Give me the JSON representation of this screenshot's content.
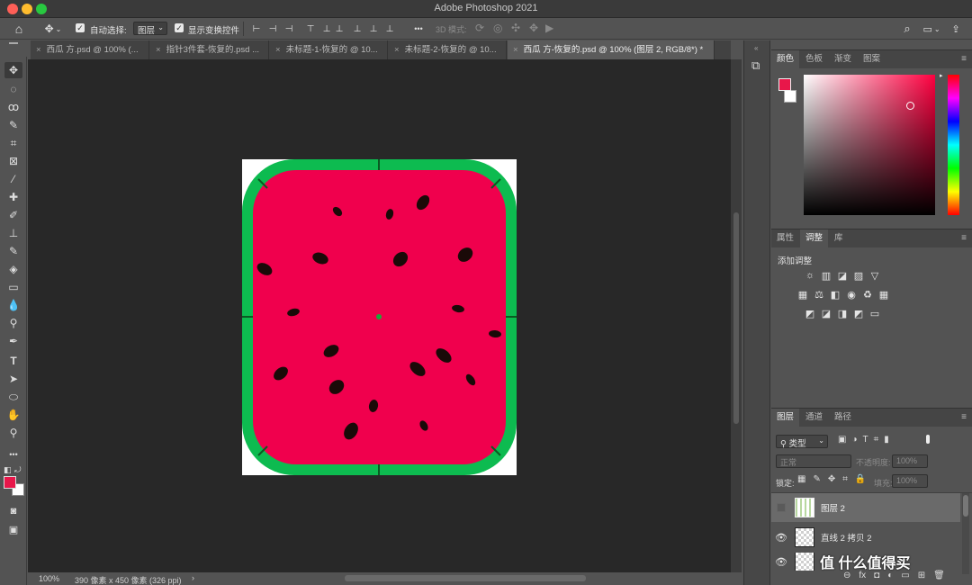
{
  "window": {
    "title": "Adobe Photoshop 2021",
    "traffic_colors": [
      "#fe5f57",
      "#febc2e",
      "#28c840"
    ]
  },
  "options": {
    "auto_select_label": "自动选择:",
    "auto_select_value": "图层",
    "show_transform_label": "显示变换控件",
    "mode_3d_label": "3D 模式:",
    "more_label": "•••"
  },
  "tabs": [
    {
      "label": "西瓜 方.psd @ 100% (..."
    },
    {
      "label": "指针3件套-恢复的.psd ..."
    },
    {
      "label": "未标题-1-恢复的 @ 10..."
    },
    {
      "label": "未标题-2-恢复的 @ 10..."
    },
    {
      "label": "西瓜 方-恢复的.psd @ 100% (图层 2, RGB/8*) *"
    }
  ],
  "tab_close": "×",
  "status": {
    "zoom": "100%",
    "doc_info": "390 像素 x 450 像素 (326 ppi)",
    "arrow": "›"
  },
  "color_panel": {
    "tabs": [
      "颜色",
      "色板",
      "渐变",
      "图案"
    ],
    "foreground": "#e8174a",
    "background": "#ffffff",
    "hue": "#ff0040"
  },
  "adjust_panel": {
    "tabs": [
      "属性",
      "调整",
      "库"
    ],
    "heading": "添加调整",
    "row1": [
      "☼",
      "▥",
      "◪",
      "▨",
      "▽"
    ],
    "row2": [
      "▦",
      "⚖",
      "◧",
      "◉",
      "♻",
      "▦"
    ],
    "row3": [
      "◩",
      "◪",
      "◨",
      "◩",
      "▭"
    ]
  },
  "layers_panel": {
    "tabs": [
      "图层",
      "通道",
      "路径"
    ],
    "filter_label": "类型",
    "filter_icons": [
      "▣",
      "◑",
      "T",
      "⌗",
      "▮"
    ],
    "blend_mode": "正常",
    "opacity_label": "不透明度:",
    "opacity_value": "100%",
    "lock_label": "锁定:",
    "fill_label": "填充:",
    "fill_value": "100%",
    "layers": [
      {
        "name": "图层 2",
        "visible": false
      },
      {
        "name": "直线 2 拷贝 2",
        "visible": true
      }
    ],
    "footer_icons": [
      "⊖",
      "fx",
      "◘",
      "◐",
      "▭",
      "⊞",
      "🗑"
    ]
  },
  "watermark": "值 什么值得买",
  "menu_glyph": "≡",
  "colors": {
    "rind": "#0dbb50",
    "flesh": "#f0004d",
    "seed": "#1a0a08",
    "center_dot": "#1aaa3a"
  }
}
